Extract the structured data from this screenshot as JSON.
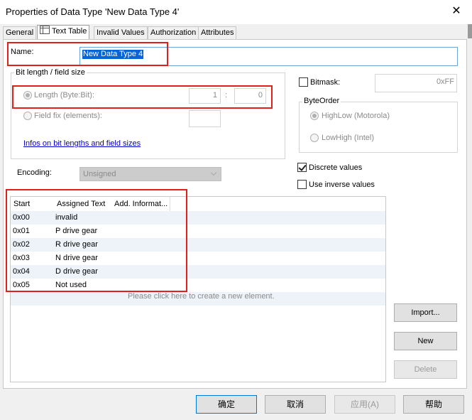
{
  "window": {
    "title": "Properties of Data Type 'New Data Type 4'",
    "close_glyph": "✕"
  },
  "tabs": [
    {
      "label": "General"
    },
    {
      "label": "Text Table",
      "icon": "table-icon",
      "active": true
    },
    {
      "label": "Invalid Values"
    },
    {
      "label": "Authorization"
    },
    {
      "label": "Attributes"
    }
  ],
  "name": {
    "label": "Name:",
    "value": "New Data Type 4"
  },
  "bit_length": {
    "title": "Bit length / field size",
    "length_label": "Length (Byte:Bit):",
    "byte_value": "1",
    "separator": ":",
    "bit_value": "0",
    "field_fix_label": "Field fix (elements):",
    "link": "Infos on bit lengths and field sizes"
  },
  "bitmask": {
    "label": "Bitmask:",
    "value": "0xFF"
  },
  "byte_order": {
    "title": "ByteOrder",
    "options": [
      "HighLow (Motorola)",
      "LowHigh (Intel)"
    ],
    "selected": "HighLow (Motorola)"
  },
  "encoding": {
    "label": "Encoding:",
    "value": "Unsigned"
  },
  "options": {
    "discrete": "Discrete values",
    "discrete_checked": true,
    "inverse": "Use inverse values",
    "inverse_checked": false
  },
  "table": {
    "columns": [
      "Start",
      "Assigned Text",
      "Add. Informat..."
    ],
    "rows": [
      {
        "start": "0x00",
        "text": "invalid"
      },
      {
        "start": "0x01",
        "text": "P drive gear"
      },
      {
        "start": "0x02",
        "text": "R drive gear"
      },
      {
        "start": "0x03",
        "text": "N drive gear"
      },
      {
        "start": "0x04",
        "text": "D drive gear"
      },
      {
        "start": "0x05",
        "text": "Not used"
      }
    ],
    "hint": "Please click here to create a new element."
  },
  "side_buttons": {
    "import": "Import...",
    "new": "New",
    "delete": "Delete"
  },
  "footer": {
    "ok": "确定",
    "cancel": "取消",
    "apply": "应用(A)",
    "help": "帮助"
  },
  "colors": {
    "highlight": "#e0201a",
    "selection": "#0a64d8",
    "link": "#0000cc"
  }
}
